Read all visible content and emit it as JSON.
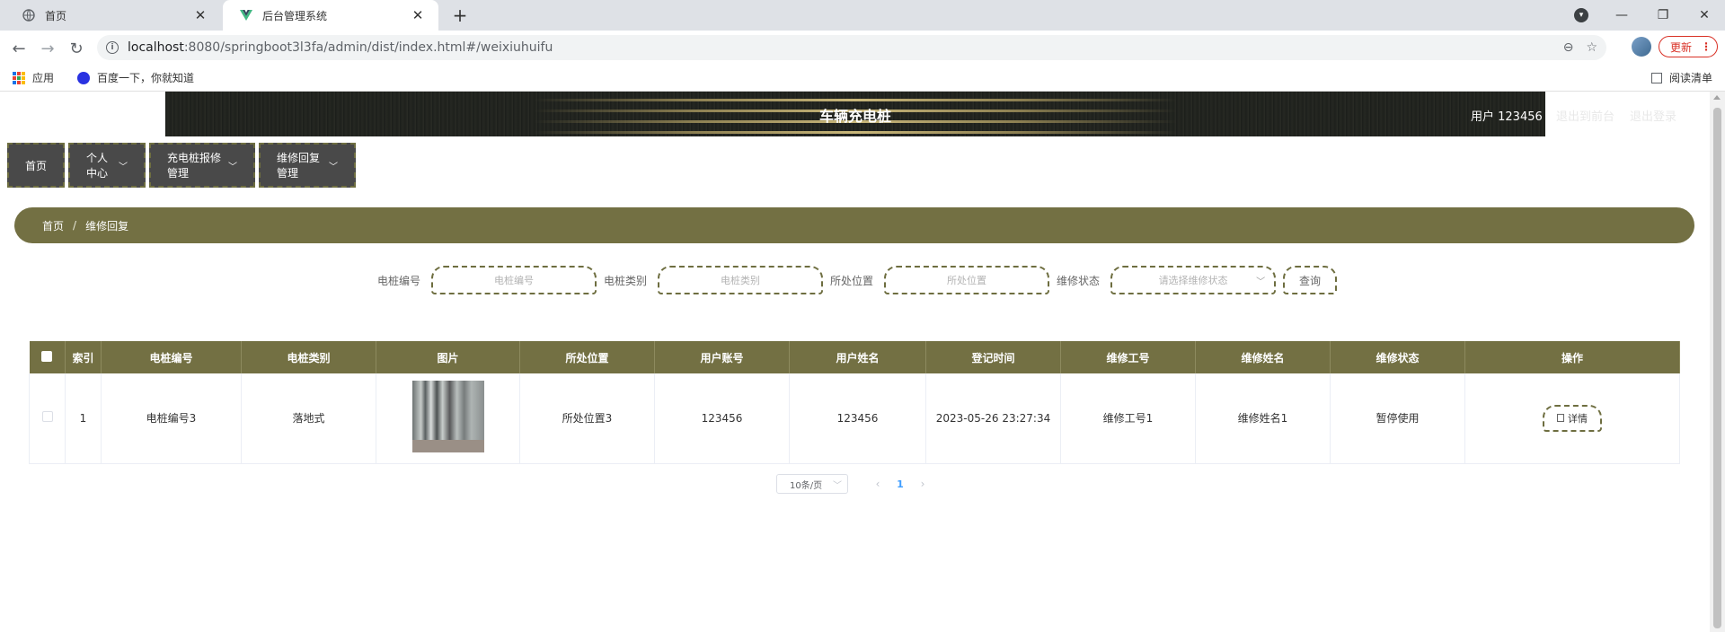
{
  "browser": {
    "tabs": [
      {
        "title": "首页",
        "active": false
      },
      {
        "title": "后台管理系统",
        "active": true
      }
    ],
    "url_host": "localhost",
    "url_rest": ":8080/springboot3l3fa/admin/dist/index.html#/weixiuhuifu",
    "update_label": "更新",
    "bookmarks": [
      "应用",
      "百度一下，你就知道"
    ],
    "reading_list": "阅读清单"
  },
  "header": {
    "title": "车辆充电桩",
    "user": "用户 123456",
    "ghost_links": [
      "退出到前台",
      "退出登录"
    ]
  },
  "menu": [
    {
      "label": "首页",
      "dropdown": false
    },
    {
      "label": "个人中心",
      "dropdown": true
    },
    {
      "label": "充电桩报修管理",
      "dropdown": true
    },
    {
      "label": "维修回复管理",
      "dropdown": true
    }
  ],
  "breadcrumb": [
    "首页",
    "维修回复"
  ],
  "search": {
    "fields": [
      {
        "label": "电桩编号",
        "placeholder": "电桩编号",
        "select": false
      },
      {
        "label": "电桩类别",
        "placeholder": "电桩类别",
        "select": false
      },
      {
        "label": "所处位置",
        "placeholder": "所处位置",
        "select": false
      },
      {
        "label": "维修状态",
        "placeholder": "请选择维修状态",
        "select": true
      }
    ],
    "button": "查询"
  },
  "table": {
    "columns": [
      "索引",
      "电桩编号",
      "电桩类别",
      "图片",
      "所处位置",
      "用户账号",
      "用户姓名",
      "登记时间",
      "维修工号",
      "维修姓名",
      "维修状态",
      "操作"
    ],
    "rows": [
      {
        "index": "1",
        "code": "电桩编号3",
        "category": "落地式",
        "location": "所处位置3",
        "account": "123456",
        "username": "123456",
        "time": "2023-05-26 23:27:34",
        "worker_id": "维修工号1",
        "worker_name": "维修姓名1",
        "status": "暂停使用",
        "action": "详情"
      }
    ]
  },
  "pagination": {
    "page_size": "10条/页",
    "current": "1"
  },
  "colors": {
    "accent": "#737043",
    "menu_bg": "#494949"
  }
}
